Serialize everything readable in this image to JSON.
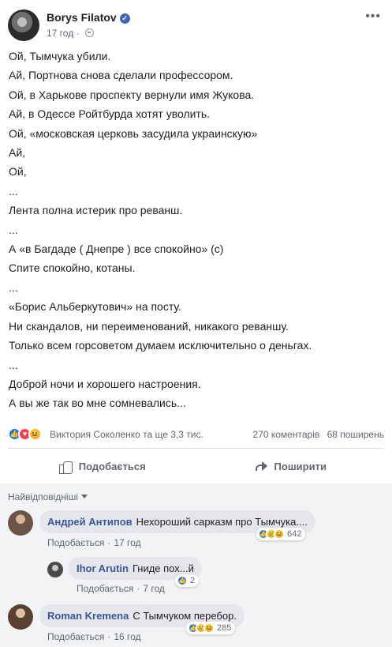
{
  "post": {
    "author": "Borys Filatov",
    "time": "17 год",
    "lines": [
      "Ой, Тымчука убили.",
      "Ай, Портнова снова сделали профессором.",
      "Ой, в Харькове проспекту вернули имя Жукова.",
      "Ай, в Одессе Ройтбурда хотят уволить.",
      "Ой, «московская церковь засудила украинскую»",
      "Ай,",
      "Ой,",
      "...",
      "Лента полна истерик про реванш.",
      "...",
      "А «в Багдаде ( Днепре ) все спокойно» (с)",
      "Спите спокойно, котаны.",
      "...",
      "«Борис Альберкутович» на посту.",
      "Ни скандалов, ни переименований, никакого реваншу.",
      "Только всем горсоветом думаем исключительно о деньгах.",
      "...",
      "Доброй ночи и хорошего настроения.",
      "А вы же так во мне сомневались..."
    ]
  },
  "stats": {
    "reactions_text": "Виктория Соколенко та ще 3,3 тис.",
    "comments": "270 коментарів",
    "shares": "68 поширень"
  },
  "actions": {
    "like": "Подобається",
    "share": "Поширити"
  },
  "comments_section": {
    "sort_label": "Найвідповідніші",
    "comments": [
      {
        "author": "Андрей Антипов",
        "text": "Нехороший сарказм про Тымчука....",
        "like": "Подобається",
        "time": "17 год",
        "reactions": "642"
      },
      {
        "author": "Ihor Arutin",
        "text": "Гниде пох...й",
        "like": "Подобається",
        "time": "7 год",
        "reactions": "2"
      },
      {
        "author": "Roman Kremena",
        "text": "С Тымчуком перебор.",
        "like": "Подобається",
        "time": "16 год",
        "reactions": "285"
      }
    ]
  },
  "icons": {
    "verified": "verified-badge-icon",
    "globe": "globe-icon",
    "more": "more-options-icon",
    "like": "thumbs-up-icon",
    "share": "share-arrow-icon"
  },
  "colors": {
    "link": "#385898",
    "accent": "#4267b2",
    "muted": "#606770",
    "comment_bubble": "#e4e6eb"
  }
}
